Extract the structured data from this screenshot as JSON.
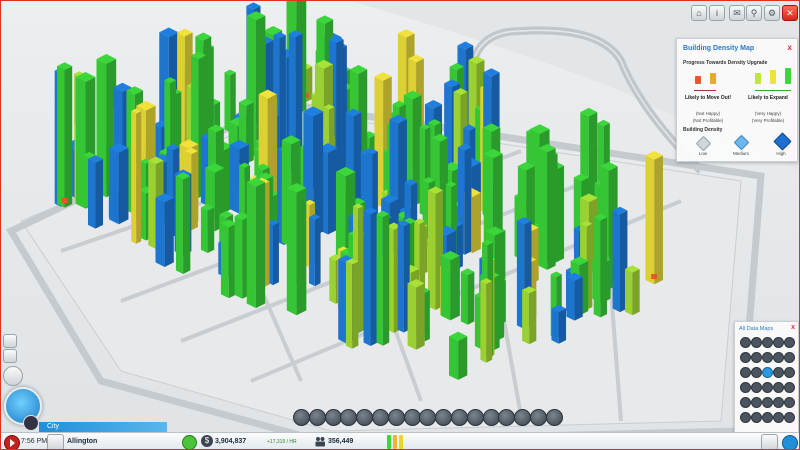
{
  "top_right_buttons": [
    {
      "name": "home-icon",
      "label": "⌂"
    },
    {
      "name": "info-icon",
      "label": "i"
    },
    {
      "name": "chat-icon",
      "label": "✉"
    },
    {
      "name": "search-icon",
      "label": "⚲"
    },
    {
      "name": "settings-icon",
      "label": "⚙"
    },
    {
      "name": "close-icon",
      "label": "✕"
    }
  ],
  "density_panel": {
    "title": "Building Density Map",
    "close_label": "x",
    "subtitle": "Progress Towards Density Upgrade",
    "left_label": "Likely to Move Out!",
    "left_note_1": "(Not Happy)",
    "left_note_2": "(Not Profitable)",
    "right_label": "Likely to Expand",
    "right_note_1": "(Very Happy)",
    "right_note_2": "(Very Profitable)",
    "section_title": "Building Density",
    "density_levels": [
      "Low",
      "Medium",
      "High"
    ],
    "scale_colors": [
      "#e8552a",
      "#e9a92a",
      "#f0e23a",
      "#bde83a",
      "#3ad63a"
    ],
    "density_colors": [
      "#cfd6dc",
      "#6fb6ec",
      "#1f6fd0"
    ]
  },
  "data_maps_panel": {
    "title": "All Data Maps",
    "close_label": "x",
    "icons": [
      "power",
      "water",
      "sewage",
      "garbage",
      "fire",
      "health",
      "police",
      "crime",
      "education",
      "land-value",
      "wealth",
      "happiness",
      "density",
      "traffic",
      "transit",
      "tourism",
      "pollution",
      "air",
      "ground",
      "radiation",
      "wind",
      "coal",
      "ore",
      "oil",
      "map-1",
      "map-2",
      "map-3",
      "map-4",
      "map-5",
      "map-6"
    ]
  },
  "left_buttons": [
    "zoom-button",
    "layers-button",
    "regions-button"
  ],
  "toolbar": {
    "tools": [
      "road-tool",
      "zone-tool",
      "power-tool",
      "water-tool",
      "sewage-tool",
      "garbage-tool",
      "government-tool",
      "fire-tool",
      "health-tool",
      "police-tool",
      "education-tool",
      "transport-tool",
      "parks-tool",
      "landmark-tool",
      "bulldoze-tool",
      "specialization-tool",
      "disaster-tool"
    ]
  },
  "city_tab": {
    "label": "City"
  },
  "status_bar": {
    "time": "7:56 PM",
    "city_name": "Allington",
    "funds": "3,904,837",
    "income": "+17,319 / HR",
    "population": "356,449"
  },
  "scene": {
    "dominant_colors": {
      "background": "#eef0f1",
      "road": "#b6bcc2",
      "high_density": "#1f7fe0",
      "very_happy": "#3ad63a",
      "happy": "#a9e236",
      "neutral": "#f0e23a",
      "unhappy": "#e8552a"
    }
  }
}
